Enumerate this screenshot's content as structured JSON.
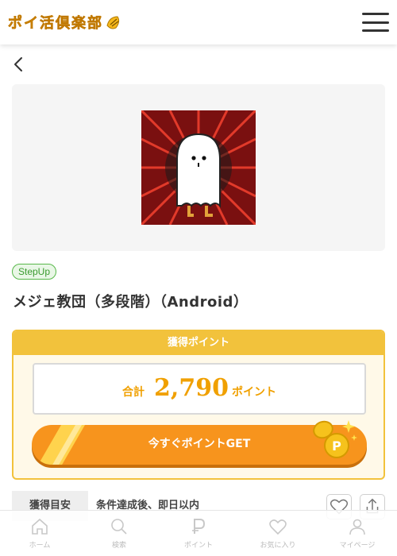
{
  "header": {
    "logo_text": "ポイ活倶楽部",
    "menu_icon": "hamburger-menu-icon"
  },
  "nav": {
    "back_icon": "chevron-left-icon"
  },
  "offer": {
    "badge": "StepUp",
    "title": "メジェ教団（多段階）（Android）",
    "image_icon": "ghost-illustration"
  },
  "points_card": {
    "heading": "獲得ポイント",
    "total_label": "合計",
    "total_value": "2,790",
    "total_unit": "ポイント",
    "cta_label": "今すぐポイントGET"
  },
  "reward_info": {
    "label": "獲得目安",
    "value": "条件達成後、即日以内"
  },
  "bottom_nav": {
    "items": [
      {
        "label": "ホーム",
        "icon": "home-icon"
      },
      {
        "label": "検索",
        "icon": "search-icon"
      },
      {
        "label": "ポイント",
        "icon": "points-icon"
      },
      {
        "label": "お気に入り",
        "icon": "heart-icon"
      },
      {
        "label": "マイページ",
        "icon": "user-icon"
      }
    ]
  },
  "colors": {
    "accent_yellow": "#f2c23c",
    "cta_orange": "#f7941d",
    "badge_green": "#58b84a",
    "points_text": "#f0a000"
  }
}
